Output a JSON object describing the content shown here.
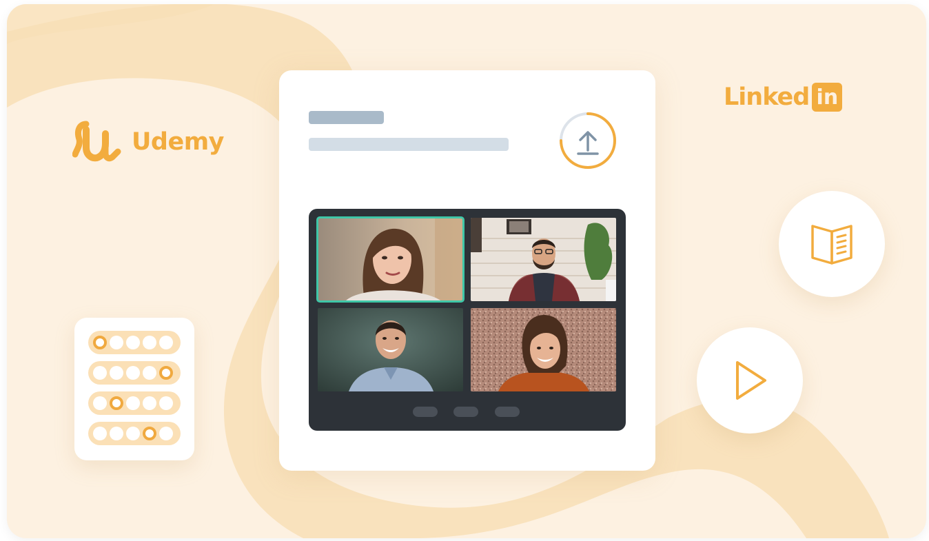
{
  "brands": {
    "udemy": {
      "name": "Udemy",
      "color": "#f2ac3e",
      "icon": "udemy-u-icon"
    },
    "linkedin": {
      "word": "Linked",
      "badge": "in",
      "color": "#f2ac3e"
    }
  },
  "colors": {
    "background": "#fdf1e1",
    "blob": "#f8dfb6",
    "accent": "#f2ac3e",
    "active_speaker": "#3fc7a8",
    "panel": "#2d3238"
  },
  "upload": {
    "icon": "upload-icon",
    "progress": 0.75
  },
  "video_call": {
    "participants": [
      {
        "id": "participant-1",
        "active": true
      },
      {
        "id": "participant-2",
        "active": false
      },
      {
        "id": "participant-3",
        "active": false
      },
      {
        "id": "participant-4",
        "active": false
      }
    ],
    "controls": [
      "control-1",
      "control-2",
      "control-3"
    ]
  },
  "quiz_rows": [
    {
      "selected_index": 0
    },
    {
      "selected_index": 4
    },
    {
      "selected_index": 1
    },
    {
      "selected_index": 3
    }
  ],
  "widgets": {
    "book": {
      "icon": "book-icon"
    },
    "play": {
      "icon": "play-icon"
    }
  }
}
